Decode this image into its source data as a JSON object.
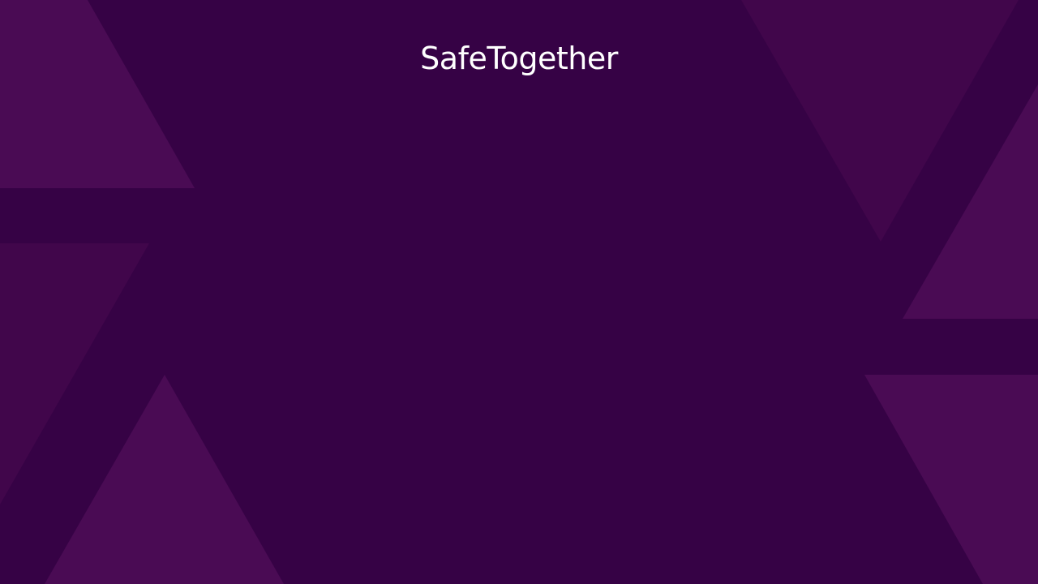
{
  "app": {
    "title": "SafeTogether"
  },
  "colors": {
    "background": "#360245",
    "triangle_light": "#4a0b54",
    "triangle_mid": "#41064b",
    "title_text": "#ffffff"
  }
}
